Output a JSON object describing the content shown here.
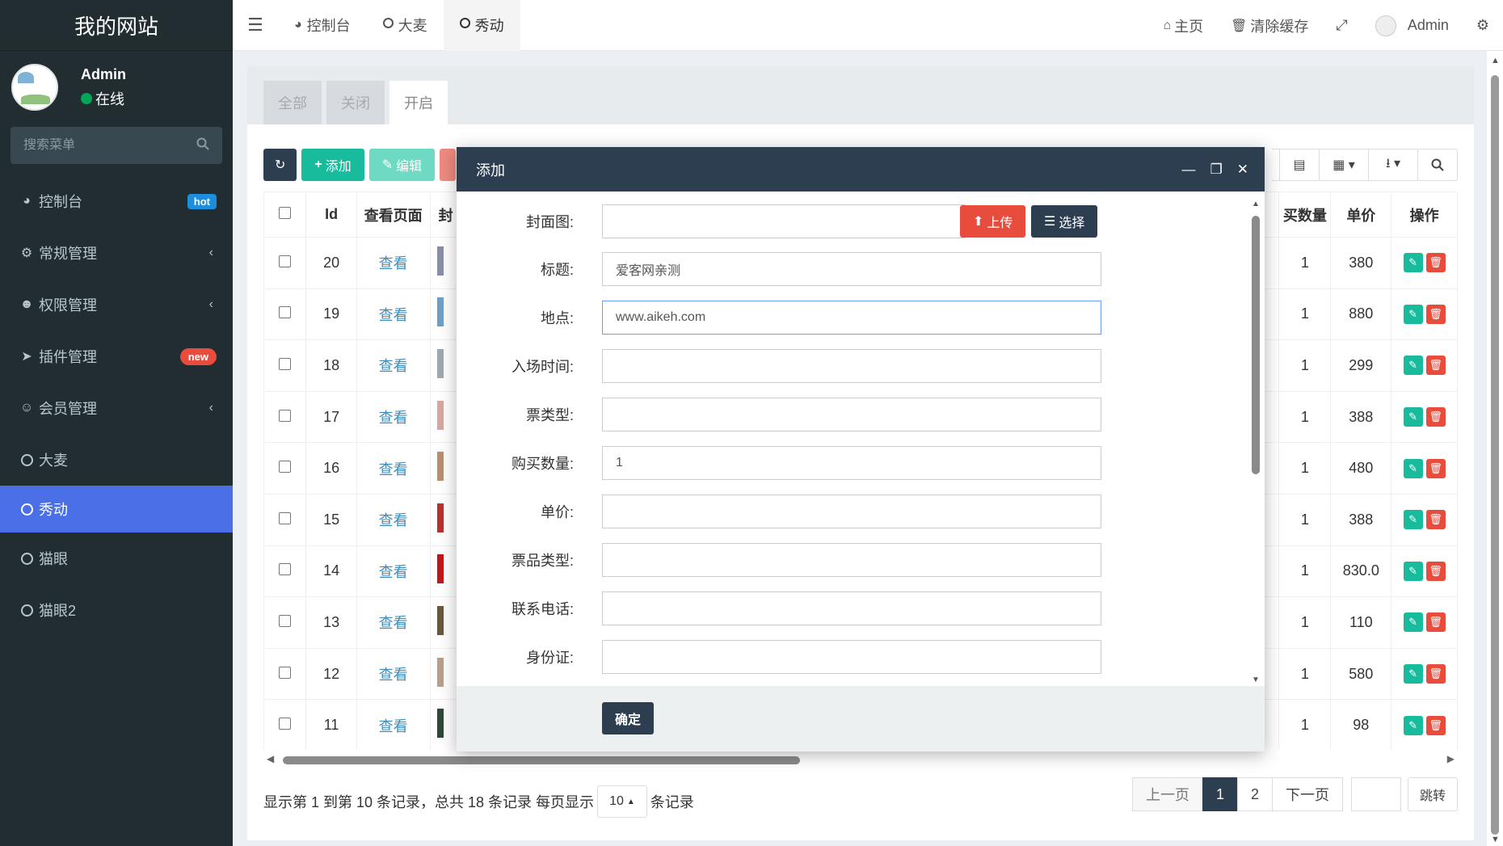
{
  "sidebar": {
    "logo": "我的网站",
    "user": {
      "name": "Admin",
      "status": "在线"
    },
    "search_placeholder": "搜索菜单",
    "items": [
      {
        "label": "控制台",
        "icon": "dashboard-icon",
        "badge": "hot"
      },
      {
        "label": "常规管理",
        "icon": "cogs-icon",
        "expandable": true
      },
      {
        "label": "权限管理",
        "icon": "users-icon",
        "expandable": true
      },
      {
        "label": "插件管理",
        "icon": "rocket-icon",
        "badge": "new"
      },
      {
        "label": "会员管理",
        "icon": "user-circle-icon",
        "expandable": true
      },
      {
        "label": "大麦",
        "icon": "circle-o-icon"
      },
      {
        "label": "秀动",
        "icon": "circle-o-icon",
        "active": true
      },
      {
        "label": "猫眼",
        "icon": "circle-o-icon"
      },
      {
        "label": "猫眼2",
        "icon": "circle-o-icon"
      }
    ]
  },
  "topbar": {
    "tabs": [
      {
        "label": "控制台",
        "icon": "dashboard-icon"
      },
      {
        "label": "大麦",
        "icon": "circle-o-icon"
      },
      {
        "label": "秀动",
        "icon": "circle-o-icon",
        "active": true
      }
    ],
    "home": "主页",
    "clear_cache": "清除缓存",
    "admin": "Admin"
  },
  "panel_tabs": [
    "全部",
    "关闭",
    "开启"
  ],
  "toolbar": {
    "add": "添加",
    "edit": "编辑"
  },
  "table": {
    "headers": [
      "Id",
      "查看页面",
      "封",
      "买数量",
      "单价",
      "操作"
    ],
    "rows": [
      {
        "id": "20",
        "view": "查看",
        "qty": "1",
        "price": "380"
      },
      {
        "id": "19",
        "view": "查看",
        "qty": "1",
        "price": "880"
      },
      {
        "id": "18",
        "view": "查看",
        "qty": "1",
        "price": "299"
      },
      {
        "id": "17",
        "view": "查看",
        "qty": "1",
        "price": "388"
      },
      {
        "id": "16",
        "view": "查看",
        "qty": "1",
        "price": "480"
      },
      {
        "id": "15",
        "view": "查看",
        "qty": "1",
        "price": "388"
      },
      {
        "id": "14",
        "view": "查看",
        "qty": "1",
        "price": "830.0"
      },
      {
        "id": "13",
        "view": "查看",
        "qty": "1",
        "price": "110"
      },
      {
        "id": "12",
        "view": "查看",
        "qty": "1",
        "price": "580"
      },
      {
        "id": "11",
        "view": "查看",
        "qty": "1",
        "price": "98"
      }
    ]
  },
  "footer": {
    "info": "显示第 1 到第 10 条记录，总共 18 条记录 每页显示",
    "page_size": "10",
    "suffix": "条记录",
    "prev": "上一页",
    "pages": [
      "1",
      "2"
    ],
    "next": "下一页",
    "jump": "跳转"
  },
  "modal": {
    "title": "添加",
    "fields": [
      {
        "label": "封面图:",
        "value": ""
      },
      {
        "label": "标题:",
        "value": "爱客网亲测"
      },
      {
        "label": "地点:",
        "value": "www.aikeh.com"
      },
      {
        "label": "入场时间:",
        "value": ""
      },
      {
        "label": "票类型:",
        "value": ""
      },
      {
        "label": "购买数量:",
        "value": "1"
      },
      {
        "label": "单价:",
        "value": ""
      },
      {
        "label": "票品类型:",
        "value": ""
      },
      {
        "label": "联系电话:",
        "value": ""
      },
      {
        "label": "身份证:",
        "value": ""
      }
    ],
    "upload": "上传",
    "choose": "选择",
    "ok": "确定"
  },
  "colors": {
    "sidebar_bg": "#222d32",
    "active_menu": "#4b6fe6",
    "primary_dark": "#2c3e50",
    "success": "#18bc9c",
    "danger": "#e74c3c"
  }
}
